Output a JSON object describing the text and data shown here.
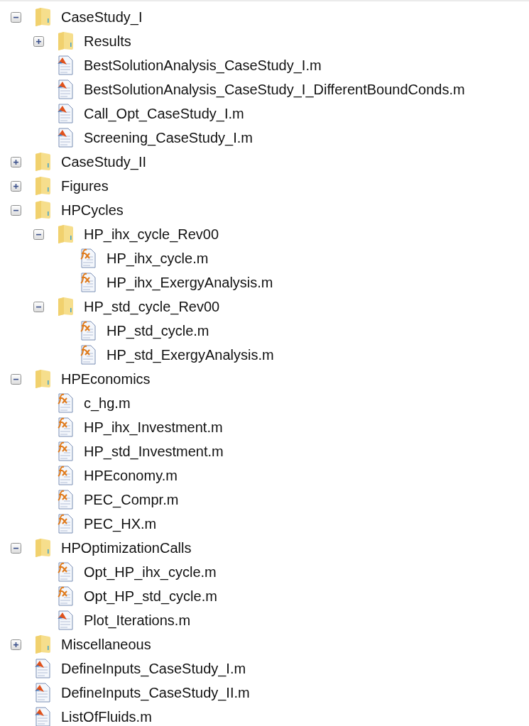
{
  "tree": [
    {
      "kind": "folder",
      "name": "CaseStudy_I",
      "expanded": true,
      "children": [
        {
          "kind": "folder",
          "name": "Results",
          "expanded": false
        },
        {
          "kind": "script",
          "name": "BestSolutionAnalysis_CaseStudy_I.m"
        },
        {
          "kind": "script",
          "name": "BestSolutionAnalysis_CaseStudy_I_DifferentBoundConds.m"
        },
        {
          "kind": "script",
          "name": "Call_Opt_CaseStudy_I.m"
        },
        {
          "kind": "script",
          "name": "Screening_CaseStudy_I.m"
        }
      ]
    },
    {
      "kind": "folder",
      "name": "CaseStudy_II",
      "expanded": false
    },
    {
      "kind": "folder",
      "name": "Figures",
      "expanded": false
    },
    {
      "kind": "folder",
      "name": "HPCycles",
      "expanded": true,
      "children": [
        {
          "kind": "folder",
          "name": "HP_ihx_cycle_Rev00",
          "expanded": true,
          "children": [
            {
              "kind": "function",
              "name": "HP_ihx_cycle.m"
            },
            {
              "kind": "function",
              "name": "HP_ihx_ExergyAnalysis.m"
            }
          ]
        },
        {
          "kind": "folder",
          "name": "HP_std_cycle_Rev00",
          "expanded": true,
          "children": [
            {
              "kind": "function",
              "name": "HP_std_cycle.m"
            },
            {
              "kind": "function",
              "name": "HP_std_ExergyAnalysis.m"
            }
          ]
        }
      ]
    },
    {
      "kind": "folder",
      "name": "HPEconomics",
      "expanded": true,
      "children": [
        {
          "kind": "function",
          "name": "c_hg.m"
        },
        {
          "kind": "function",
          "name": "HP_ihx_Investment.m"
        },
        {
          "kind": "function",
          "name": "HP_std_Investment.m"
        },
        {
          "kind": "function",
          "name": "HPEconomy.m"
        },
        {
          "kind": "function",
          "name": "PEC_Compr.m"
        },
        {
          "kind": "function",
          "name": "PEC_HX.m"
        }
      ]
    },
    {
      "kind": "folder",
      "name": "HPOptimizationCalls",
      "expanded": true,
      "children": [
        {
          "kind": "function",
          "name": "Opt_HP_ihx_cycle.m"
        },
        {
          "kind": "function",
          "name": "Opt_HP_std_cycle.m"
        },
        {
          "kind": "script",
          "name": "Plot_Iterations.m"
        }
      ]
    },
    {
      "kind": "folder",
      "name": "Miscellaneous",
      "expanded": false
    },
    {
      "kind": "script",
      "name": "DefineInputs_CaseStudy_I.m"
    },
    {
      "kind": "script",
      "name": "DefineInputs_CaseStudy_II.m"
    },
    {
      "kind": "script",
      "name": "ListOfFluids.m"
    }
  ]
}
